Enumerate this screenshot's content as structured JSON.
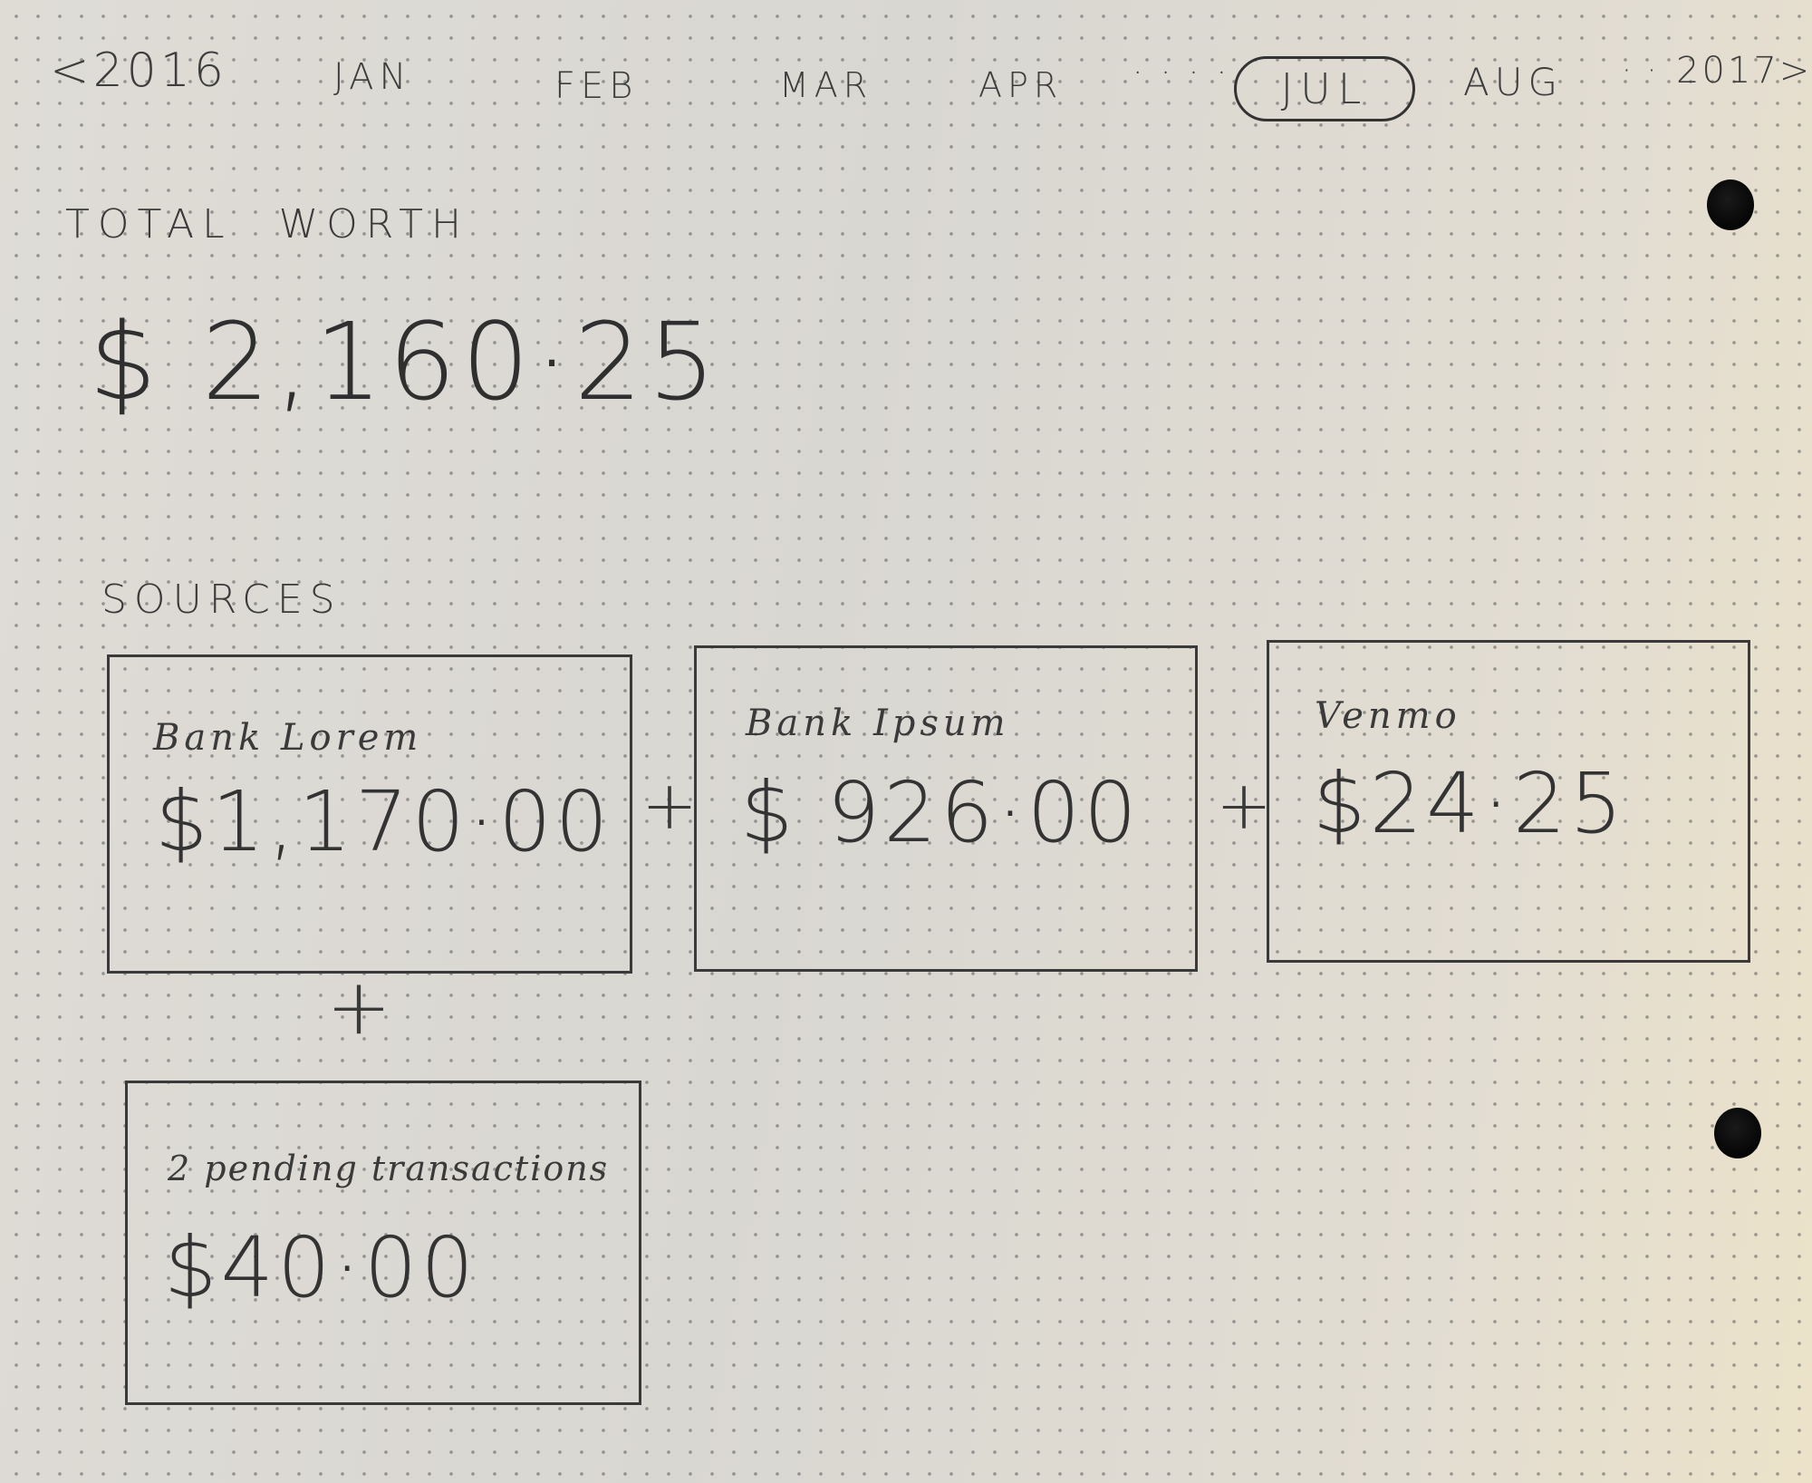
{
  "nav": {
    "prev_year": "<2016",
    "months": {
      "jan": "JAN",
      "feb": "FEB",
      "mar": "MAR",
      "apr": "APR",
      "jul": "JUL",
      "aug": "AUG"
    },
    "ellipsis_1": "· · · ·",
    "ellipsis_2": "· ·",
    "next_year": "2017>",
    "selected": "JUL"
  },
  "total": {
    "label": "TOTAL WORTH",
    "value": "$ 2,160·25"
  },
  "sources": {
    "label": "SOURCES",
    "items": [
      {
        "name": "Bank Lorem",
        "amount": "$1,170·00"
      },
      {
        "name": "Bank Ipsum",
        "amount": "$ 926·00"
      },
      {
        "name": "Venmo",
        "amount": "$24·25"
      }
    ],
    "pending": {
      "name": "2 pending transactions",
      "amount": "$40·00"
    },
    "operator": "+"
  }
}
